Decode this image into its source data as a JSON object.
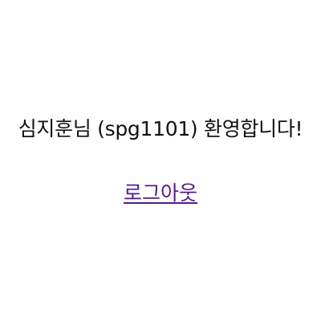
{
  "welcome": {
    "text": "심지훈님 (spg1101) 환영합니다!"
  },
  "logout": {
    "label": "로그아웃"
  },
  "colors": {
    "background": "#ffffff",
    "text": "#111111",
    "visited_link": "#551a8b"
  }
}
